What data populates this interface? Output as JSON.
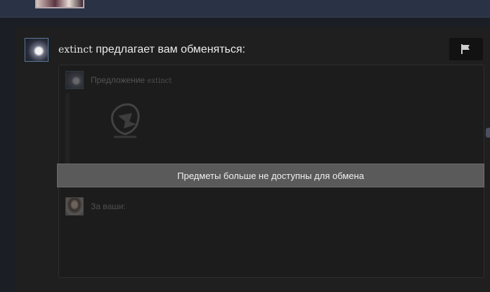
{
  "top": {
    "avatar_icon": "user-avatar"
  },
  "message": {
    "sender_name": "extinct",
    "headline_text": " предлагает вам обменяться:",
    "avatar_icon": "sender-avatar",
    "flag_icon": "flag-icon"
  },
  "offer": {
    "label_prefix": "Предложение ",
    "sender_name": "extinct",
    "item_icon": "item-thumbnail-icon",
    "unavailable_banner": "Предметы больше не доступны для обмена",
    "yours_label": "За ваши:"
  },
  "colors": {
    "background": "#1b1e24",
    "panel": "#1f1f1f",
    "banner": "#5a5a5a",
    "top_strip": "#2a3345"
  }
}
